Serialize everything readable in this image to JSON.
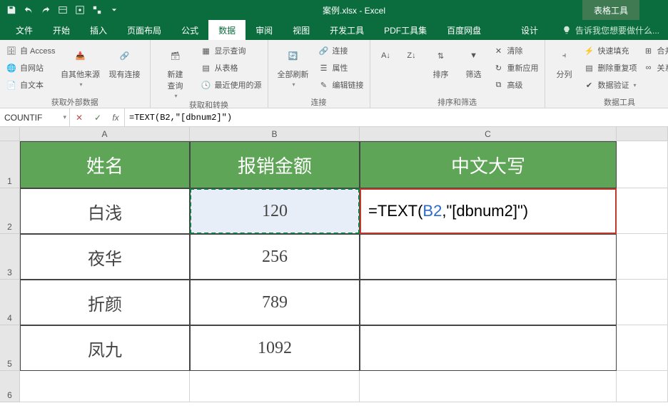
{
  "title": "案例.xlsx - Excel",
  "context_tab": "表格工具",
  "tabs": {
    "file": "文件",
    "home": "开始",
    "insert": "插入",
    "layout": "页面布局",
    "formulas": "公式",
    "data": "数据",
    "review": "审阅",
    "view": "视图",
    "dev": "开发工具",
    "pdf": "PDF工具集",
    "baidu": "百度网盘",
    "design": "设计"
  },
  "tellme": "告诉我您想要做什么...",
  "ribbon": {
    "ext": {
      "access": "自 Access",
      "web": "自网站",
      "text": "自文本",
      "other": "自其他来源",
      "conn": "现有连接",
      "label": "获取外部数据"
    },
    "query": {
      "new": "新建\n查询",
      "show": "显示查询",
      "table": "从表格",
      "recent": "最近使用的源",
      "label": "获取和转换"
    },
    "refresh": {
      "all": "全部刷新",
      "conn": "连接",
      "prop": "属性",
      "edit": "编辑链接",
      "label": "连接"
    },
    "sort": {
      "sort": "排序",
      "filter": "筛选",
      "clear": "清除",
      "reapply": "重新应用",
      "adv": "高级",
      "label": "排序和筛选"
    },
    "tools": {
      "ttc": "分列",
      "flash": "快速填充",
      "dup": "删除重复项",
      "valid": "数据验证",
      "consol": "合并计算",
      "rel": "关系",
      "label": "数据工具"
    }
  },
  "name_box": "COUNTIF",
  "formula": "=TEXT(B2,\"[dbnum2]\")",
  "columns": [
    "A",
    "B",
    "C"
  ],
  "headers": {
    "c1": "姓名",
    "c2": "报销金额",
    "c3": "中文大写"
  },
  "rows": [
    {
      "c1": "白浅",
      "c2": "120"
    },
    {
      "c1": "夜华",
      "c2": "256"
    },
    {
      "c1": "折颜",
      "c2": "789"
    },
    {
      "c1": "凤九",
      "c2": "1092"
    }
  ],
  "formula_cell": {
    "prefix": "=TEXT(",
    "ref": "B2",
    "suffix": ",\"[dbnum2]\")"
  },
  "chart_data": {
    "type": "table",
    "title": "报销金额",
    "columns": [
      "姓名",
      "报销金额",
      "中文大写"
    ],
    "rows": [
      [
        "白浅",
        120,
        "=TEXT(B2,\"[dbnum2]\")"
      ],
      [
        "夜华",
        256,
        ""
      ],
      [
        "折颜",
        789,
        ""
      ],
      [
        "凤九",
        1092,
        ""
      ]
    ]
  }
}
